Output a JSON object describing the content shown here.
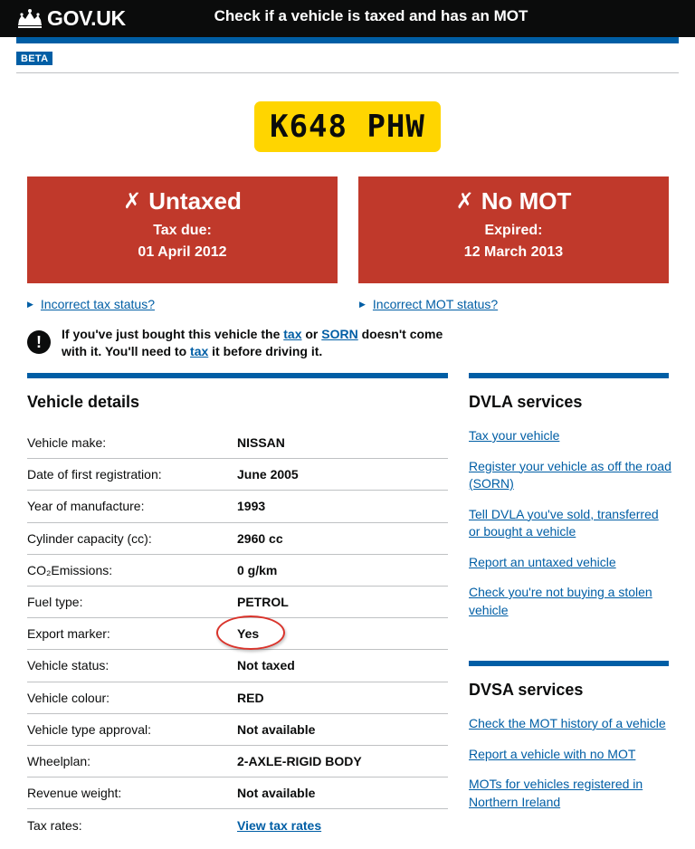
{
  "header": {
    "logo_text": "GOV.UK",
    "service_name": "Check if a vehicle is taxed and has an MOT"
  },
  "phase_banner": {
    "tag": "BETA"
  },
  "registration": "K648 PHW",
  "status": {
    "tax": {
      "icon": "✗",
      "title": "Untaxed",
      "subtitle": "Tax due:",
      "date": "01 April 2012",
      "color": "#c0392b"
    },
    "mot": {
      "icon": "✗",
      "title": "No MOT",
      "subtitle": "Expired:",
      "date": "12 March 2013",
      "color": "#c0392b"
    }
  },
  "disclosures": {
    "tax": "Incorrect tax status?",
    "mot": "Incorrect MOT status?"
  },
  "warning": {
    "icon": "!",
    "part1": "If you've just bought this vehicle the ",
    "link_tax": "tax",
    "part2": " or ",
    "link_sorn": "SORN",
    "part3": " doesn't come with it. You'll need to ",
    "link_tax2": "tax",
    "part4": " it before driving it."
  },
  "vehicle_details": {
    "heading": "Vehicle details",
    "rows": [
      {
        "label": "Vehicle make:",
        "value": "NISSAN"
      },
      {
        "label": "Date of first registration:",
        "value": "June 2005"
      },
      {
        "label": "Year of manufacture:",
        "value": "1993"
      },
      {
        "label": "Cylinder capacity (cc):",
        "value": "2960 cc"
      },
      {
        "label": "CO₂Emissions:",
        "value": "0 g/km"
      },
      {
        "label": "Fuel type:",
        "value": "PETROL"
      },
      {
        "label": "Export marker:",
        "value": "Yes"
      },
      {
        "label": "Vehicle status:",
        "value": "Not taxed"
      },
      {
        "label": "Vehicle colour:",
        "value": "RED"
      },
      {
        "label": "Vehicle type approval:",
        "value": "Not available"
      },
      {
        "label": "Wheelplan:",
        "value": "2-AXLE-RIGID BODY"
      },
      {
        "label": "Revenue weight:",
        "value": "Not available"
      },
      {
        "label": "Tax rates:",
        "value": "View tax rates"
      }
    ]
  },
  "dvla": {
    "heading": "DVLA services",
    "links": [
      "Tax your vehicle",
      "Register your vehicle as off the road (SORN)",
      "Tell DVLA you've sold, transferred or bought a vehicle",
      "Report an untaxed vehicle",
      "Check you're not buying a stolen vehicle"
    ]
  },
  "dvsa": {
    "heading": "DVSA services",
    "links": [
      "Check the MOT history of a vehicle",
      "Report a vehicle with no MOT",
      "MOTs for vehicles registered in Northern Ireland"
    ]
  },
  "colors": {
    "brand_blue": "#005ea5",
    "plate_yellow": "#ffd500",
    "status_red": "#c0392b",
    "annotation_ring": "#d9332b"
  }
}
